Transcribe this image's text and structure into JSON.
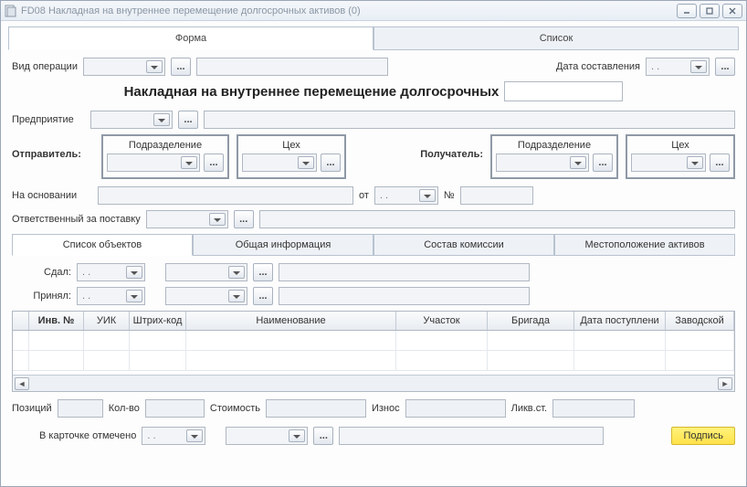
{
  "window": {
    "title": "FD08 Накладная на внутреннее перемещение долгосрочных активов (0)"
  },
  "tabs": {
    "form": "Форма",
    "list": "Список"
  },
  "labels": {
    "operation_type": "Вид операции",
    "date_created": "Дата составления",
    "doc_title": "Накладная на внутреннее перемещение долгосрочных",
    "enterprise": "Предприятие",
    "sender": "Отправитель:",
    "receiver": "Получатель:",
    "department": "Подразделение",
    "shop": "Цех",
    "based_on": "На основании",
    "from": "от",
    "number_sign": "№",
    "responsible": "Ответственный за поставку",
    "handed": "Сдал:",
    "accepted": "Принял:",
    "positions": "Позиций",
    "quantity": "Кол-во",
    "cost": "Стоимость",
    "wear": "Износ",
    "liquidation": "Ликв.ст.",
    "card_marked": "В карточке отмечено",
    "sign": "Подпись"
  },
  "values": {
    "date_created": ".  .",
    "basis_date": ".  .",
    "handed_date": ".  .",
    "accepted_date": ".  .",
    "card_date": ".  ."
  },
  "sub_tabs": {
    "objects": "Список объектов",
    "general": "Общая информация",
    "commission": "Состав комиссии",
    "locations": "Местоположение активов"
  },
  "grid": {
    "columns": {
      "inv_no": "Инв. №",
      "uik": "УИК",
      "barcode": "Штрих-код",
      "name": "Наименование",
      "section": "Участок",
      "brigade": "Бригада",
      "receipt_date": "Дата поступлени",
      "factory": "Заводской"
    }
  }
}
